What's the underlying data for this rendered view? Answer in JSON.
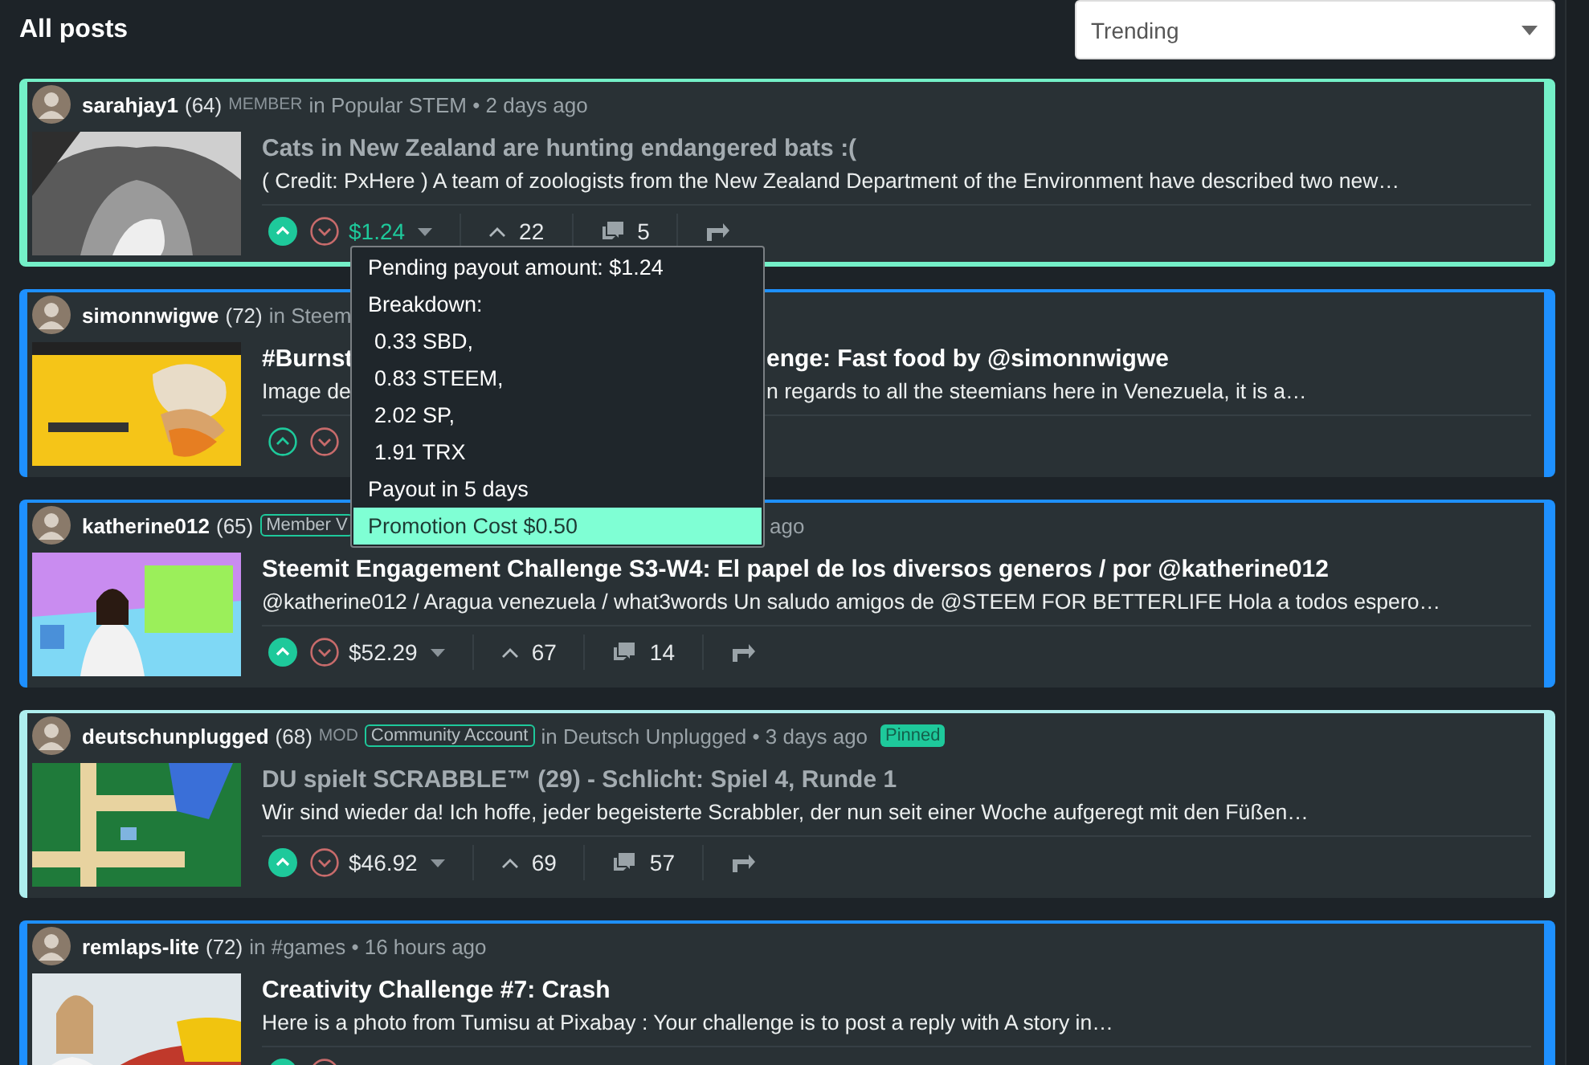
{
  "page_title": "All posts",
  "sort_select": {
    "value": "Trending"
  },
  "posts": [
    {
      "color": "#74f0c8",
      "highlighted": true,
      "author": "sarahjay1",
      "reputation": "(64)",
      "role": "MEMBER",
      "meta": "in Popular STEM • 2 days ago",
      "visited": true,
      "title": [
        "Cats in New Zealand are hunting endangered bats :("
      ],
      "excerpt": [
        "( Credit: PxHere ) A team of zoologists from the New Zealand Department of the Environment have described two new…"
      ],
      "upvoted": true,
      "actions": {
        "payout": "$1.24",
        "payout_open": true,
        "votes": "22",
        "comments": "5"
      }
    },
    {
      "color": "#1e90ff",
      "highlighted": false,
      "author": "simonnwigwe",
      "reputation": "(72)",
      "meta": "in Steem",
      "visited": false,
      "title": [
        "#Burnst",
        "enge: Fast food by  @simonnwigwe"
      ],
      "excerpt": [
        "Image de",
        "n regards to all the steemians here in Venezuela, it is a…"
      ],
      "upvoted": false
    },
    {
      "color": "#1e90ff",
      "highlighted": false,
      "author": "katherine012",
      "reputation": "(65)",
      "badge": "Member V",
      "meta_tail": "ago",
      "visited": false,
      "title": [
        "Steemit Engagement Challenge S3-W4: El papel de los diversos generos / por @katherine012"
      ],
      "excerpt": [
        "@katherine012 / Aragua venezuela / what3words Un saludo amigos de @STEEM FOR BETTERLIFE Hola a todos espero…"
      ],
      "upvoted": true,
      "actions": {
        "payout": "$52.29",
        "payout_open": false,
        "votes": "67",
        "comments": "14"
      }
    },
    {
      "color": "#aeeeee",
      "highlighted": false,
      "author": "deutschunplugged",
      "reputation": "(68)",
      "role": "MOD",
      "badge": "Community Account",
      "meta": "in Deutsch Unplugged • 3 days ago",
      "pinned": "Pinned",
      "visited": true,
      "title": [
        "DU spielt SCRABBLE™ (29) - Schlicht: Spiel 4, Runde 1"
      ],
      "excerpt": [
        "Wir sind wieder da! Ich hoffe, jeder begeisterte Scrabbler, der nun seit einer Woche aufgeregt mit den Füßen…"
      ],
      "upvoted": true,
      "actions": {
        "payout": "$46.92",
        "payout_open": false,
        "votes": "69",
        "comments": "57"
      }
    },
    {
      "color": "#1e90ff",
      "highlighted": false,
      "author": "remlaps-lite",
      "reputation": "(72)",
      "meta": "in #games • 16 hours ago",
      "visited": false,
      "title": [
        "Creativity Challenge #7: Crash"
      ],
      "excerpt": [
        "Here is a photo from Tumisu at Pixabay : Your challenge is to post a reply with A story in…"
      ],
      "upvoted": true
    }
  ],
  "payout_popup": {
    "items": [
      {
        "text": "Pending payout amount: $1.24",
        "selected": false
      },
      {
        "text": "Breakdown:",
        "selected": false,
        "children": [
          {
            "text": "0.33 SBD,"
          },
          {
            "text": "0.83 STEEM,"
          },
          {
            "text": "2.02 SP,"
          },
          {
            "text": "1.91 TRX"
          }
        ]
      },
      {
        "text": "Payout in 5 days",
        "selected": false
      },
      {
        "text": "Promotion Cost $0.50",
        "selected": true
      }
    ]
  }
}
